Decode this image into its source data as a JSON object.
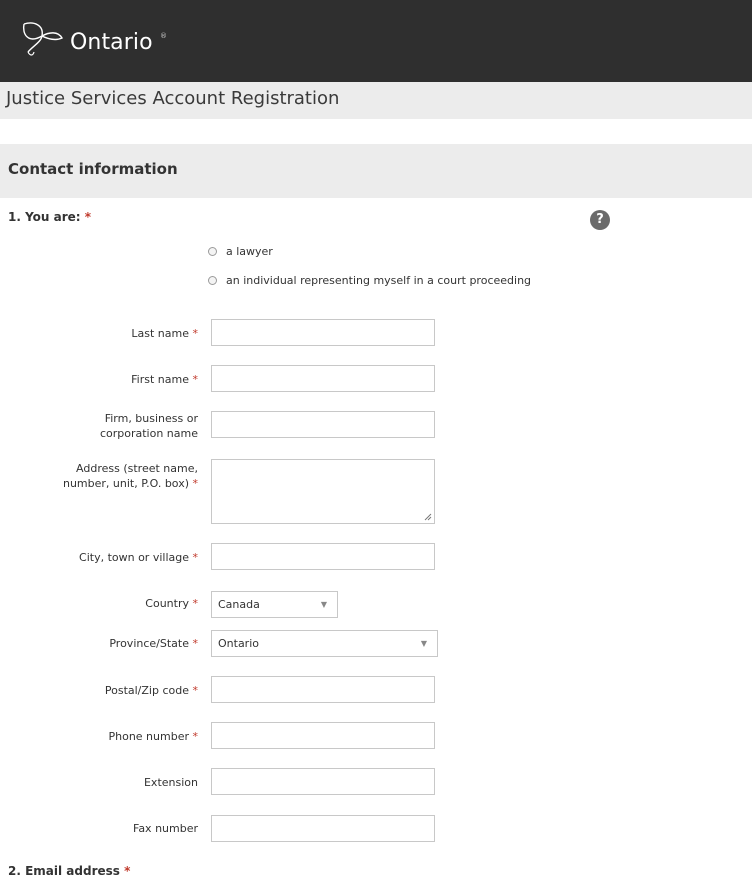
{
  "header": {
    "brand": "Ontario",
    "brand_mark": "®",
    "subtitle": "Justice Services Account Registration"
  },
  "section": {
    "title": "Contact information"
  },
  "questions": {
    "q1": {
      "label": "1. You are:",
      "required_mark": "*",
      "help_icon": "?"
    },
    "q2": {
      "label": "2. Email address",
      "required_mark": "*"
    }
  },
  "radio_options": [
    {
      "label": "a lawyer",
      "selected": false
    },
    {
      "label": "an individual representing myself in a court proceeding",
      "selected": false
    }
  ],
  "fields": {
    "last_name": {
      "label": "Last name",
      "required_mark": "*",
      "value": ""
    },
    "first_name": {
      "label": "First name",
      "required_mark": "*",
      "value": ""
    },
    "firm_line1": "Firm, business or",
    "firm_line2": "corporation name",
    "firm": {
      "value": ""
    },
    "address_line1": "Address (street name,",
    "address_line2": "number, unit, P.O. box)",
    "address": {
      "required_mark": "*",
      "value": ""
    },
    "city": {
      "label": "City, town or village",
      "required_mark": "*",
      "value": ""
    },
    "country": {
      "label": "Country",
      "required_mark": "*",
      "value": "Canada"
    },
    "province": {
      "label": "Province/State",
      "required_mark": "*",
      "value": "Ontario"
    },
    "postal": {
      "label": "Postal/Zip code",
      "required_mark": "*",
      "value": ""
    },
    "phone": {
      "label": "Phone number",
      "required_mark": "*",
      "value": ""
    },
    "extension": {
      "label": "Extension",
      "value": ""
    },
    "fax": {
      "label": "Fax number",
      "value": ""
    }
  },
  "icons": {
    "logo": "ontario-trillium-icon",
    "help": "help-icon",
    "dropdown": "chevron-down-icon"
  },
  "colors": {
    "header_bg": "#2f2f2f",
    "band_bg": "#ececec",
    "required": "#c0392b"
  }
}
